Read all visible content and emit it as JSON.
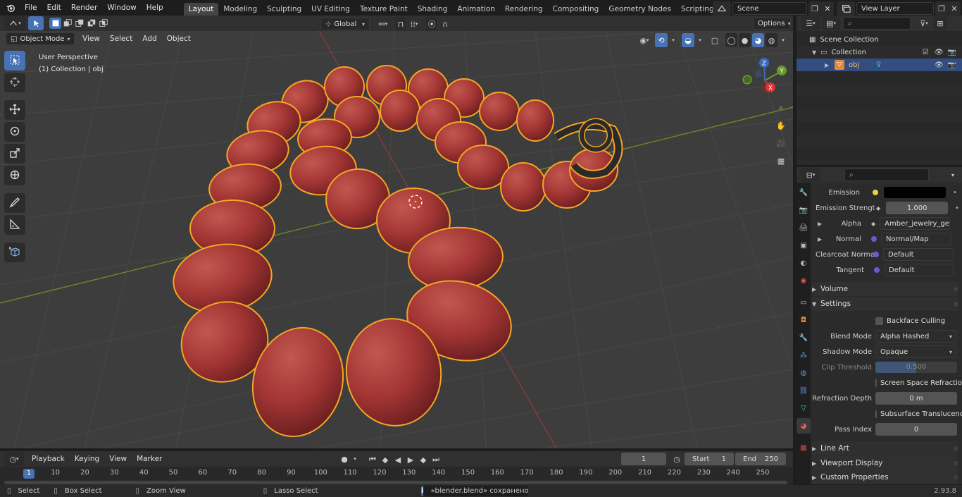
{
  "topbar": {
    "menus": [
      "File",
      "Edit",
      "Render",
      "Window",
      "Help"
    ],
    "workspaces": [
      "Layout",
      "Modeling",
      "Sculpting",
      "UV Editing",
      "Texture Paint",
      "Shading",
      "Animation",
      "Rendering",
      "Compositing",
      "Geometry Nodes",
      "Scripting"
    ],
    "active_workspace": "Layout",
    "scene": "Scene",
    "view_layer": "View Layer"
  },
  "viewport_header": {
    "mode": "Object Mode",
    "menus": [
      "View",
      "Select",
      "Add",
      "Object"
    ],
    "transform_orientation": "Global",
    "options_label": "Options"
  },
  "viewport": {
    "perspective": "User Perspective",
    "collection_info": "(1) Collection | obj",
    "gizmo": {
      "x": "X",
      "y": "Y",
      "z": "Z"
    }
  },
  "outliner": {
    "scene_collection": "Scene Collection",
    "collection": "Collection",
    "object": "obj"
  },
  "properties": {
    "emission_label": "Emission",
    "emission_strength_label": "Emission Strengt",
    "emission_strength_value": "1.000",
    "alpha_label": "Alpha",
    "alpha_value": "Amber_jewelry_geo...",
    "normal_label": "Normal",
    "normal_value": "Normal/Map",
    "clearcoat_normal_label": "Clearcoat Normal",
    "clearcoat_normal_value": "Default",
    "tangent_label": "Tangent",
    "tangent_value": "Default",
    "volume_section": "Volume",
    "settings_section": "Settings",
    "backface_culling": "Backface Culling",
    "blend_mode_label": "Blend Mode",
    "blend_mode_value": "Alpha Hashed",
    "shadow_mode_label": "Shadow Mode",
    "shadow_mode_value": "Opaque",
    "clip_threshold_label": "Clip Threshold",
    "clip_threshold_value": "0.500",
    "ssr_label": "Screen Space Refraction",
    "refraction_depth_label": "Refraction Depth",
    "refraction_depth_value": "0 m",
    "subsurface_label": "Subsurface Translucency",
    "pass_index_label": "Pass Index",
    "pass_index_value": "0",
    "line_art_section": "Line Art",
    "viewport_display_section": "Viewport Display",
    "custom_properties_section": "Custom Properties"
  },
  "timeline": {
    "menus": [
      "Playback",
      "Keying",
      "View",
      "Marker"
    ],
    "current_frame": "1",
    "start_label": "Start",
    "start_value": "1",
    "end_label": "End",
    "end_value": "250",
    "ruler": [
      "1",
      "10",
      "20",
      "30",
      "40",
      "50",
      "60",
      "70",
      "80",
      "90",
      "100",
      "110",
      "120",
      "130",
      "140",
      "150",
      "160",
      "170",
      "180",
      "190",
      "200",
      "210",
      "220",
      "230",
      "240",
      "250"
    ]
  },
  "status": {
    "select": "Select",
    "box_select": "Box Select",
    "zoom_view": "Zoom View",
    "lasso_select": "Lasso Select",
    "message": "«blender.blend» сохранено",
    "version": "2.93.8"
  },
  "colors": {
    "accent": "#4772b3",
    "selection_outline": "#f5a623",
    "bead": "#a83a38",
    "grid_x_axis": "#8a3a3a",
    "grid_y_axis": "#6a8a2a"
  }
}
